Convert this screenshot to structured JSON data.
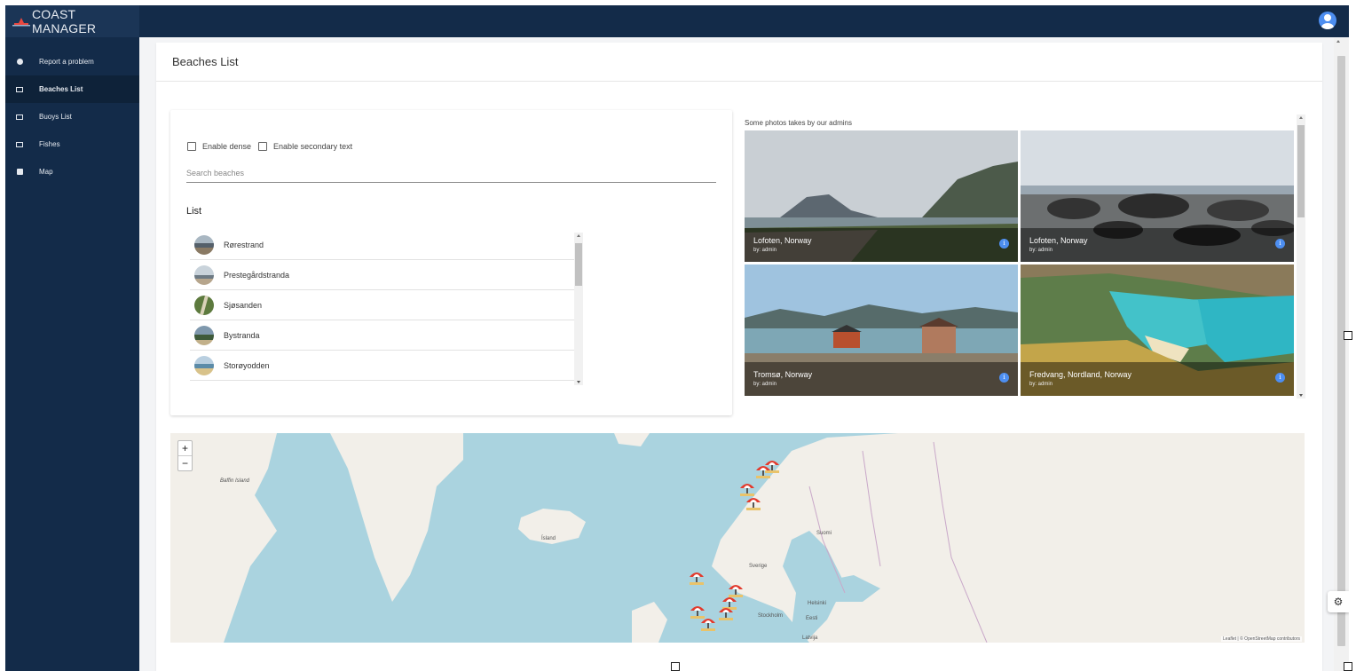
{
  "app": {
    "title": "COAST MANAGER"
  },
  "sidebar": {
    "items": [
      {
        "label": "Report a problem",
        "icon": "report-dot-icon",
        "active": false
      },
      {
        "label": "Beaches List",
        "icon": "list-icon",
        "active": true
      },
      {
        "label": "Buoys List",
        "icon": "list-icon",
        "active": false
      },
      {
        "label": "Fishes",
        "icon": "list-icon",
        "active": false
      },
      {
        "label": "Map",
        "icon": "map-icon",
        "active": false
      }
    ]
  },
  "header": {
    "avatar_icon": "account-circle-icon"
  },
  "page": {
    "title": "Beaches List"
  },
  "options": {
    "dense_label": "Enable dense",
    "secondary_label": "Enable secondary text"
  },
  "search": {
    "placeholder": "Search beaches"
  },
  "list": {
    "title": "List",
    "items": [
      {
        "name": "Rørestrand"
      },
      {
        "name": "Prestegårdstranda"
      },
      {
        "name": "Sjøsanden"
      },
      {
        "name": "Bystranda"
      },
      {
        "name": "Storøyodden"
      }
    ]
  },
  "gallery": {
    "caption": "Some photos takes by our admins",
    "photos": [
      {
        "title": "Lofoten, Norway",
        "author": "by: admin"
      },
      {
        "title": "Lofoten, Norway",
        "author": "by: admin"
      },
      {
        "title": "Tromsø, Norway",
        "author": "by: admin"
      },
      {
        "title": "Fredvang, Nordland, Norway",
        "author": "by: admin"
      }
    ]
  },
  "map": {
    "zoom_in": "+",
    "zoom_out": "−",
    "attribution": "Leaflet | © OpenStreetMap contributors",
    "labels": {
      "baffin": "Baffin Island",
      "island": "Ísland",
      "suomi": "Suomi",
      "sverige": "Sverige",
      "stockholm": "Stockholm",
      "eesti": "Eesti",
      "latvija": "Latvija",
      "helsinki": "Helsinki"
    },
    "marker_icon": "beach-umbrella-icon"
  },
  "colors": {
    "sidebar": "#132b49",
    "accent": "#4d8ef0",
    "water": "#aad3df",
    "land": "#f2efe9"
  }
}
